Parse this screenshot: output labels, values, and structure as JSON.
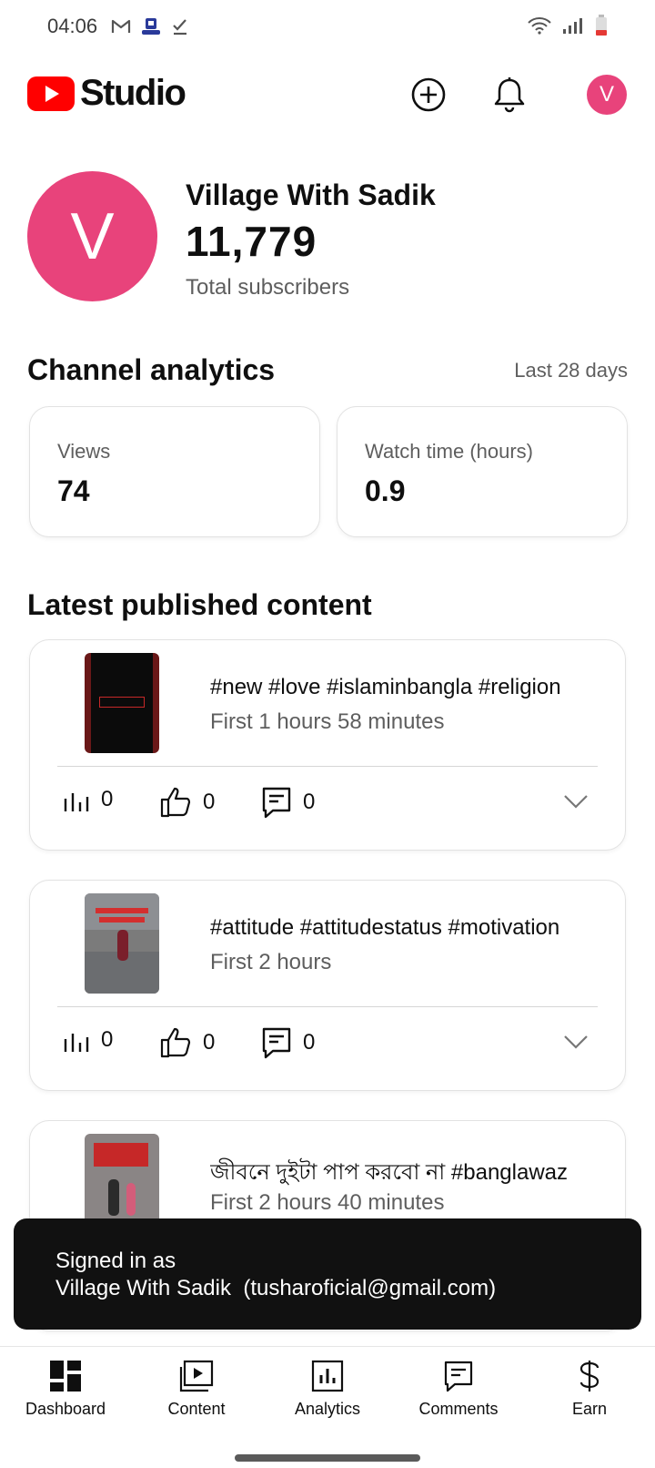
{
  "status_bar": {
    "time": "04:06",
    "left_icons": [
      "gmail-icon",
      "app-notification-icon",
      "check-icon"
    ],
    "right_icons": [
      "wifi-icon",
      "signal-icon",
      "battery-low-icon"
    ]
  },
  "app_bar": {
    "logo_text": "Studio",
    "brand_color": "#ff0000",
    "avatar_letter": "V"
  },
  "channel": {
    "avatar_letter": "V",
    "avatar_color": "#e8437b",
    "name": "Village With Sadik",
    "subscribers": "11,779",
    "subscribers_label": "Total subscribers"
  },
  "analytics": {
    "title": "Channel analytics",
    "period": "Last 28 days",
    "metrics": [
      {
        "label": "Views",
        "value": "74"
      },
      {
        "label": "Watch time (hours)",
        "value": "0.9"
      }
    ]
  },
  "latest": {
    "title": "Latest published content",
    "items": [
      {
        "title": "#new #love #islaminbangla #religion",
        "subtitle": "First 1 hours 58 minutes",
        "views": "0",
        "likes": "0",
        "comments": "0"
      },
      {
        "title": "#attitude #attitudestatus #motivation",
        "subtitle": "First 2 hours",
        "views": "0",
        "likes": "0",
        "comments": "0"
      },
      {
        "title": "জীবনে দুইটা পাপ করবো না #banglawaz",
        "subtitle": "First 2 hours 40 minutes",
        "views": "",
        "likes": "",
        "comments": ""
      }
    ]
  },
  "snackbar": {
    "line1": "Signed in as",
    "line2": "Village With Sadik  (tusharoficial@gmail.com)"
  },
  "nav": {
    "items": [
      {
        "label": "Dashboard",
        "icon": "dashboard-icon"
      },
      {
        "label": "Content",
        "icon": "content-icon"
      },
      {
        "label": "Analytics",
        "icon": "analytics-icon"
      },
      {
        "label": "Comments",
        "icon": "comments-icon"
      },
      {
        "label": "Earn",
        "icon": "dollar-icon"
      }
    ]
  }
}
